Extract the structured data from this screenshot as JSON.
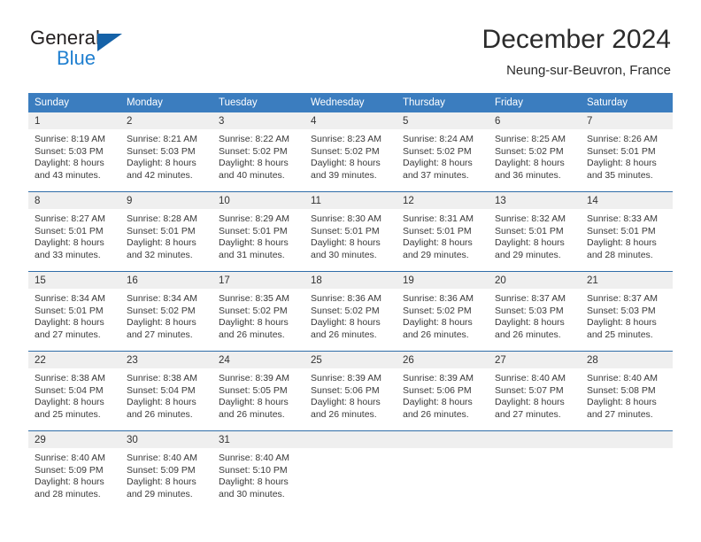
{
  "brand": {
    "line1": "General",
    "line2": "Blue",
    "mark": "triangle-mark"
  },
  "header": {
    "title": "December 2024",
    "subtitle": "Neung-sur-Beuvron, France"
  },
  "colors": {
    "header_blue": "#3b7dbf",
    "separator_blue": "#2f6da8",
    "daynum_bg": "#efefef",
    "brand_blue": "#1f7fd0"
  },
  "weekday_headers": [
    "Sunday",
    "Monday",
    "Tuesday",
    "Wednesday",
    "Thursday",
    "Friday",
    "Saturday"
  ],
  "weeks": [
    [
      {
        "day": "1",
        "sunrise": "Sunrise: 8:19 AM",
        "sunset": "Sunset: 5:03 PM",
        "daylight1": "Daylight: 8 hours",
        "daylight2": "and 43 minutes."
      },
      {
        "day": "2",
        "sunrise": "Sunrise: 8:21 AM",
        "sunset": "Sunset: 5:03 PM",
        "daylight1": "Daylight: 8 hours",
        "daylight2": "and 42 minutes."
      },
      {
        "day": "3",
        "sunrise": "Sunrise: 8:22 AM",
        "sunset": "Sunset: 5:02 PM",
        "daylight1": "Daylight: 8 hours",
        "daylight2": "and 40 minutes."
      },
      {
        "day": "4",
        "sunrise": "Sunrise: 8:23 AM",
        "sunset": "Sunset: 5:02 PM",
        "daylight1": "Daylight: 8 hours",
        "daylight2": "and 39 minutes."
      },
      {
        "day": "5",
        "sunrise": "Sunrise: 8:24 AM",
        "sunset": "Sunset: 5:02 PM",
        "daylight1": "Daylight: 8 hours",
        "daylight2": "and 37 minutes."
      },
      {
        "day": "6",
        "sunrise": "Sunrise: 8:25 AM",
        "sunset": "Sunset: 5:02 PM",
        "daylight1": "Daylight: 8 hours",
        "daylight2": "and 36 minutes."
      },
      {
        "day": "7",
        "sunrise": "Sunrise: 8:26 AM",
        "sunset": "Sunset: 5:01 PM",
        "daylight1": "Daylight: 8 hours",
        "daylight2": "and 35 minutes."
      }
    ],
    [
      {
        "day": "8",
        "sunrise": "Sunrise: 8:27 AM",
        "sunset": "Sunset: 5:01 PM",
        "daylight1": "Daylight: 8 hours",
        "daylight2": "and 33 minutes."
      },
      {
        "day": "9",
        "sunrise": "Sunrise: 8:28 AM",
        "sunset": "Sunset: 5:01 PM",
        "daylight1": "Daylight: 8 hours",
        "daylight2": "and 32 minutes."
      },
      {
        "day": "10",
        "sunrise": "Sunrise: 8:29 AM",
        "sunset": "Sunset: 5:01 PM",
        "daylight1": "Daylight: 8 hours",
        "daylight2": "and 31 minutes."
      },
      {
        "day": "11",
        "sunrise": "Sunrise: 8:30 AM",
        "sunset": "Sunset: 5:01 PM",
        "daylight1": "Daylight: 8 hours",
        "daylight2": "and 30 minutes."
      },
      {
        "day": "12",
        "sunrise": "Sunrise: 8:31 AM",
        "sunset": "Sunset: 5:01 PM",
        "daylight1": "Daylight: 8 hours",
        "daylight2": "and 29 minutes."
      },
      {
        "day": "13",
        "sunrise": "Sunrise: 8:32 AM",
        "sunset": "Sunset: 5:01 PM",
        "daylight1": "Daylight: 8 hours",
        "daylight2": "and 29 minutes."
      },
      {
        "day": "14",
        "sunrise": "Sunrise: 8:33 AM",
        "sunset": "Sunset: 5:01 PM",
        "daylight1": "Daylight: 8 hours",
        "daylight2": "and 28 minutes."
      }
    ],
    [
      {
        "day": "15",
        "sunrise": "Sunrise: 8:34 AM",
        "sunset": "Sunset: 5:01 PM",
        "daylight1": "Daylight: 8 hours",
        "daylight2": "and 27 minutes."
      },
      {
        "day": "16",
        "sunrise": "Sunrise: 8:34 AM",
        "sunset": "Sunset: 5:02 PM",
        "daylight1": "Daylight: 8 hours",
        "daylight2": "and 27 minutes."
      },
      {
        "day": "17",
        "sunrise": "Sunrise: 8:35 AM",
        "sunset": "Sunset: 5:02 PM",
        "daylight1": "Daylight: 8 hours",
        "daylight2": "and 26 minutes."
      },
      {
        "day": "18",
        "sunrise": "Sunrise: 8:36 AM",
        "sunset": "Sunset: 5:02 PM",
        "daylight1": "Daylight: 8 hours",
        "daylight2": "and 26 minutes."
      },
      {
        "day": "19",
        "sunrise": "Sunrise: 8:36 AM",
        "sunset": "Sunset: 5:02 PM",
        "daylight1": "Daylight: 8 hours",
        "daylight2": "and 26 minutes."
      },
      {
        "day": "20",
        "sunrise": "Sunrise: 8:37 AM",
        "sunset": "Sunset: 5:03 PM",
        "daylight1": "Daylight: 8 hours",
        "daylight2": "and 26 minutes."
      },
      {
        "day": "21",
        "sunrise": "Sunrise: 8:37 AM",
        "sunset": "Sunset: 5:03 PM",
        "daylight1": "Daylight: 8 hours",
        "daylight2": "and 25 minutes."
      }
    ],
    [
      {
        "day": "22",
        "sunrise": "Sunrise: 8:38 AM",
        "sunset": "Sunset: 5:04 PM",
        "daylight1": "Daylight: 8 hours",
        "daylight2": "and 25 minutes."
      },
      {
        "day": "23",
        "sunrise": "Sunrise: 8:38 AM",
        "sunset": "Sunset: 5:04 PM",
        "daylight1": "Daylight: 8 hours",
        "daylight2": "and 26 minutes."
      },
      {
        "day": "24",
        "sunrise": "Sunrise: 8:39 AM",
        "sunset": "Sunset: 5:05 PM",
        "daylight1": "Daylight: 8 hours",
        "daylight2": "and 26 minutes."
      },
      {
        "day": "25",
        "sunrise": "Sunrise: 8:39 AM",
        "sunset": "Sunset: 5:06 PM",
        "daylight1": "Daylight: 8 hours",
        "daylight2": "and 26 minutes."
      },
      {
        "day": "26",
        "sunrise": "Sunrise: 8:39 AM",
        "sunset": "Sunset: 5:06 PM",
        "daylight1": "Daylight: 8 hours",
        "daylight2": "and 26 minutes."
      },
      {
        "day": "27",
        "sunrise": "Sunrise: 8:40 AM",
        "sunset": "Sunset: 5:07 PM",
        "daylight1": "Daylight: 8 hours",
        "daylight2": "and 27 minutes."
      },
      {
        "day": "28",
        "sunrise": "Sunrise: 8:40 AM",
        "sunset": "Sunset: 5:08 PM",
        "daylight1": "Daylight: 8 hours",
        "daylight2": "and 27 minutes."
      }
    ],
    [
      {
        "day": "29",
        "sunrise": "Sunrise: 8:40 AM",
        "sunset": "Sunset: 5:09 PM",
        "daylight1": "Daylight: 8 hours",
        "daylight2": "and 28 minutes."
      },
      {
        "day": "30",
        "sunrise": "Sunrise: 8:40 AM",
        "sunset": "Sunset: 5:09 PM",
        "daylight1": "Daylight: 8 hours",
        "daylight2": "and 29 minutes."
      },
      {
        "day": "31",
        "sunrise": "Sunrise: 8:40 AM",
        "sunset": "Sunset: 5:10 PM",
        "daylight1": "Daylight: 8 hours",
        "daylight2": "and 30 minutes."
      },
      {
        "day": "",
        "sunrise": "",
        "sunset": "",
        "daylight1": "",
        "daylight2": ""
      },
      {
        "day": "",
        "sunrise": "",
        "sunset": "",
        "daylight1": "",
        "daylight2": ""
      },
      {
        "day": "",
        "sunrise": "",
        "sunset": "",
        "daylight1": "",
        "daylight2": ""
      },
      {
        "day": "",
        "sunrise": "",
        "sunset": "",
        "daylight1": "",
        "daylight2": ""
      }
    ]
  ]
}
